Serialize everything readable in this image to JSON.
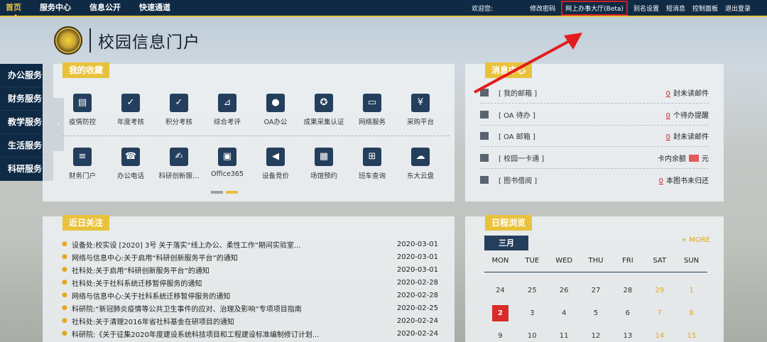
{
  "topnav": {
    "items": [
      "首页",
      "服务中心",
      "信息公开",
      "快速通道"
    ]
  },
  "toplinks": {
    "welcome": "欢迎您:",
    "change_password": "修改密码",
    "online_hall": "网上办事大厅(Beta)",
    "alias": "别名设置",
    "sms": "短消息",
    "control_panel": "控制面板",
    "logout": "退出登录"
  },
  "logo": {
    "title": "校园信息门户"
  },
  "sidebar": {
    "items": [
      "办公服务",
      "财务服务",
      "教学服务",
      "生活服务",
      "科研服务"
    ]
  },
  "favorites": {
    "tag": "我的收藏",
    "row1": [
      {
        "label": "疫情防控",
        "icon": "clipboard-icon"
      },
      {
        "label": "年度考核",
        "icon": "checklist-icon"
      },
      {
        "label": "积分考核",
        "icon": "checklist-icon"
      },
      {
        "label": "综合考评",
        "icon": "chart-board-icon"
      },
      {
        "label": "OA办公",
        "icon": "user-office-icon"
      },
      {
        "label": "成果采集认证",
        "icon": "medal-icon"
      },
      {
        "label": "网络服务",
        "icon": "monitor-icon"
      },
      {
        "label": "采购平台",
        "icon": "purchase-doc-icon"
      }
    ],
    "row2": [
      {
        "label": "财务门户",
        "icon": "finance-doc-icon"
      },
      {
        "label": "办公电话",
        "icon": "phone-book-icon"
      },
      {
        "label": "科研创新服…",
        "icon": "research-icon"
      },
      {
        "label": "Office365",
        "icon": "office-icon"
      },
      {
        "label": "设备竞价",
        "icon": "megaphone-icon"
      },
      {
        "label": "场馆预约",
        "icon": "venue-icon"
      },
      {
        "label": "班车查询",
        "icon": "bus-icon"
      },
      {
        "label": "东大云盘",
        "icon": "cloud-disk-icon"
      }
    ],
    "pager_colors": [
      "#9aa0a6",
      "#e9c23c"
    ]
  },
  "news": {
    "tag": "近日关注",
    "items": [
      {
        "title": "设备处:校实设 [2020] 3号 关于落实“线上办公、柔性工作”期间实验室...",
        "date": "2020-03-01"
      },
      {
        "title": "网络与信息中心:关于启用“科研创新服务平台”的通知",
        "date": "2020-03-01"
      },
      {
        "title": "社科处:关于启用“科研创新服务平台”的通知",
        "date": "2020-03-01"
      },
      {
        "title": "社科处:关于社科系统迁移暂停服务的通知",
        "date": "2020-02-28"
      },
      {
        "title": "网络与信息中心:关于社科系统迁移暂停服务的通知",
        "date": "2020-02-28"
      },
      {
        "title": "科研院:“新冠肺炎疫情等公共卫生事件的应对、治理及影响”专项项目指南",
        "date": "2020-02-25"
      },
      {
        "title": "社科处:关于清理2016年省社科基金在研项目的通知",
        "date": "2020-02-24"
      },
      {
        "title": "科研院:《关于征集2020年度建设系统科技项目和工程建设标准编制修订计划...",
        "date": "2020-02-24"
      }
    ]
  },
  "messages": {
    "tag": "消息中心",
    "rows": [
      {
        "label": "[ 我的邮箱 ]",
        "num": "0",
        "suffix": "封未读邮件",
        "icon": "mail-icon"
      },
      {
        "label": "[ OA 待办 ]",
        "num": "0",
        "suffix": "个待办提醒",
        "icon": "todo-icon"
      },
      {
        "label": "[ OA 邮箱 ]",
        "num": "0",
        "suffix": "封未读邮件",
        "icon": "mail-icon"
      },
      {
        "label": "[ 校园一卡通 ]",
        "prefix": "卡内余额",
        "suffix": "元",
        "icon": "card-icon"
      },
      {
        "label": "[ 图书借阅 ]",
        "num": "0",
        "suffix": "本图书未归还",
        "icon": "books-icon"
      }
    ]
  },
  "calendar": {
    "tag": "日程浏览",
    "month": "三月",
    "more": "+ MORE",
    "weekdays": [
      "MON",
      "TUE",
      "WED",
      "THU",
      "FRI",
      "SAT",
      "SUN"
    ],
    "weeks": [
      [
        "24",
        "25",
        "26",
        "27",
        "28",
        "29",
        "1"
      ],
      [
        "2",
        "3",
        "4",
        "5",
        "6",
        "7",
        "8"
      ],
      [
        "9",
        "10",
        "11",
        "12",
        "13",
        "14",
        "15"
      ]
    ],
    "today": "2",
    "colors": {
      "today": "#d82b2b",
      "weekend": "#e0a81c"
    }
  },
  "colors": {
    "navy": "#0e2a45",
    "gold": "#e9c23c",
    "highlight_box": "#d21d1d"
  }
}
